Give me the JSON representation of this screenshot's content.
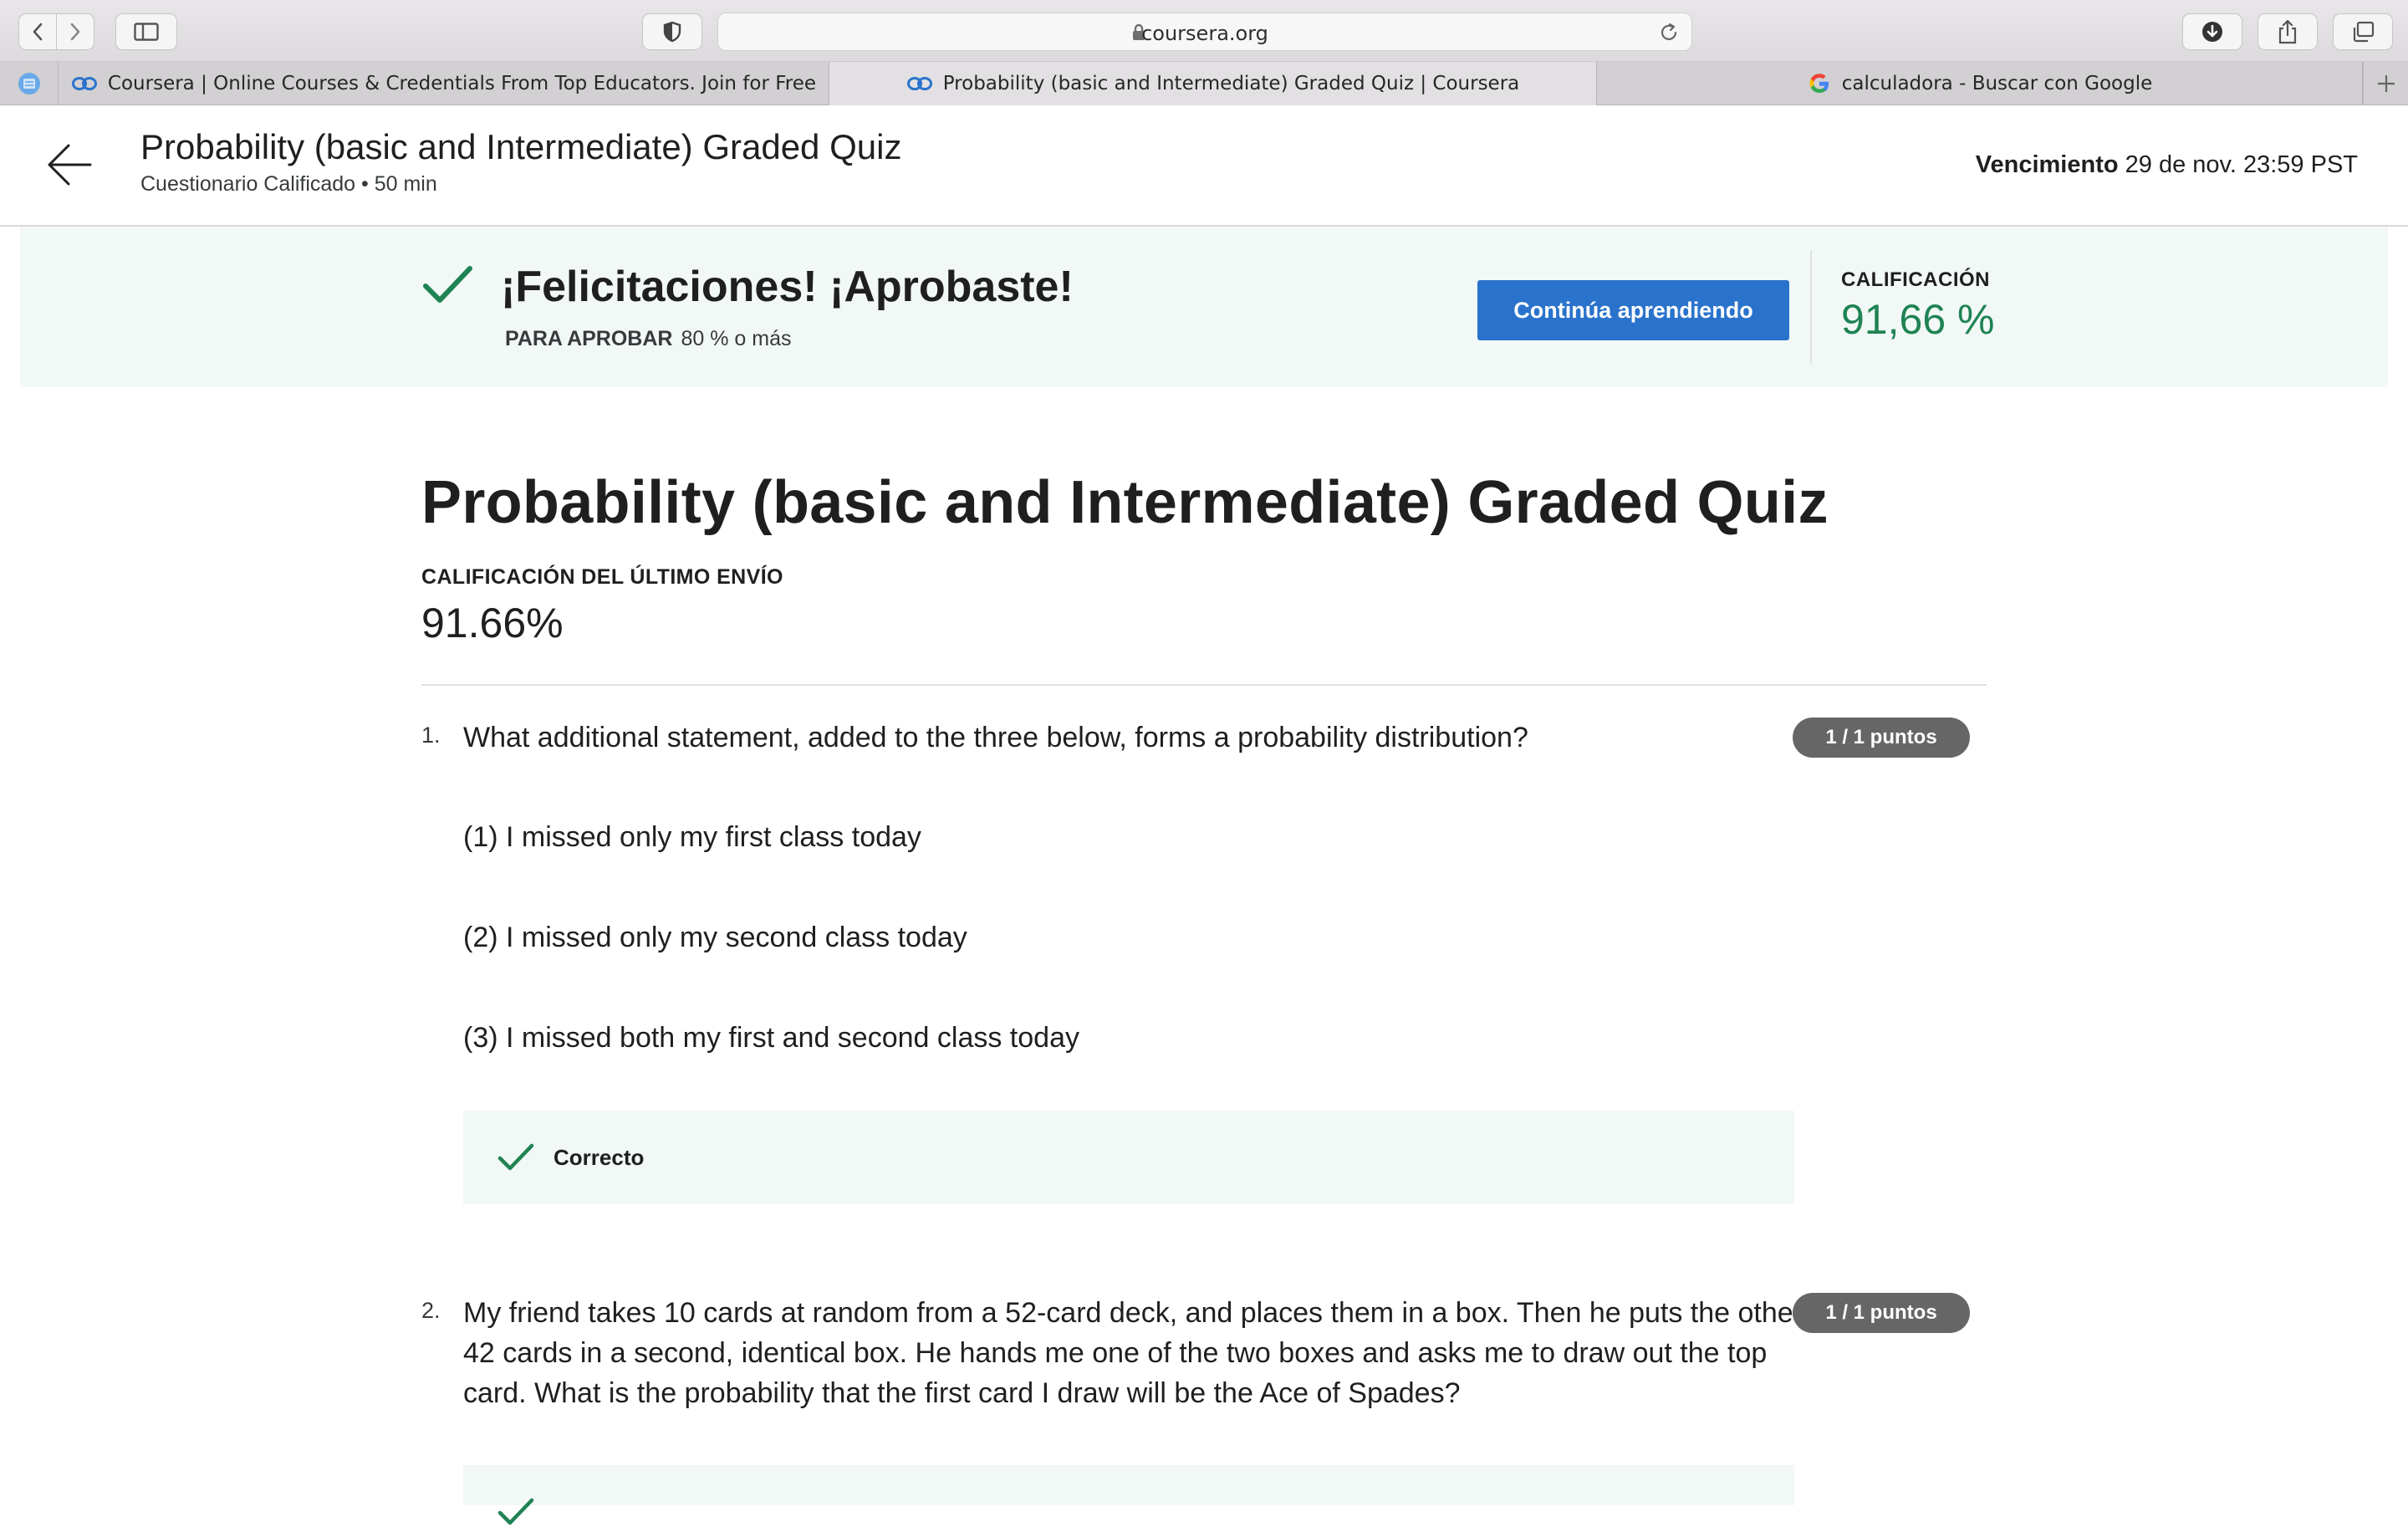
{
  "browser": {
    "url": "coursera.org",
    "tabs": [
      {
        "title": "Coursera | Online Courses & Credentials From Top Educators. Join for Free",
        "active": false,
        "favicon": "coursera-icon"
      },
      {
        "title": "Probability (basic and Intermediate) Graded Quiz | Coursera",
        "active": true,
        "favicon": "coursera-icon"
      },
      {
        "title": "calculadora - Buscar con Google",
        "active": false,
        "favicon": "google-icon"
      }
    ]
  },
  "header": {
    "title": "Probability (basic and Intermediate) Graded Quiz",
    "subtitle": "Cuestionario Calificado • 50 min",
    "due_label": "Vencimiento",
    "due_value": "29 de nov. 23:59 PST"
  },
  "result": {
    "title": "¡Felicitaciones! ¡Aprobaste!",
    "pass_label": "PARA APROBAR",
    "pass_value": "80 % o más",
    "continue_label": "Continúa aprendiendo",
    "grade_label": "CALIFICACIÓN",
    "grade_value": "91,66 %"
  },
  "quiz": {
    "title": "Probability (basic and Intermediate) Graded Quiz",
    "last_label": "CALIFICACIÓN DEL ÚLTIMO ENVÍO",
    "last_value": "91.66%"
  },
  "questions": [
    {
      "number": "1.",
      "text": "What additional statement, added to the three below, forms a probability distribution?",
      "points": "1 / 1 puntos",
      "options": [
        "(1) I missed only my first class today",
        "(2) I missed only my second class today",
        "(3) I missed both my first and second class today"
      ],
      "feedback": "Correcto"
    },
    {
      "number": "2.",
      "text_lines": [
        "My friend takes 10 cards at random from a 52-card deck, and places them in a box. Then he puts the other",
        "42 cards in a second, identical box. He hands me one of the two boxes and asks me to draw out the top",
        "card. What is the probability that the first card I draw will be the Ace of Spades?"
      ],
      "points": "1 / 1 puntos"
    }
  ],
  "colors": {
    "accent_blue": "#2a73cc",
    "success_green": "#1f8354",
    "banner_bg": "#f2f8f6",
    "points_badge": "#666666"
  }
}
